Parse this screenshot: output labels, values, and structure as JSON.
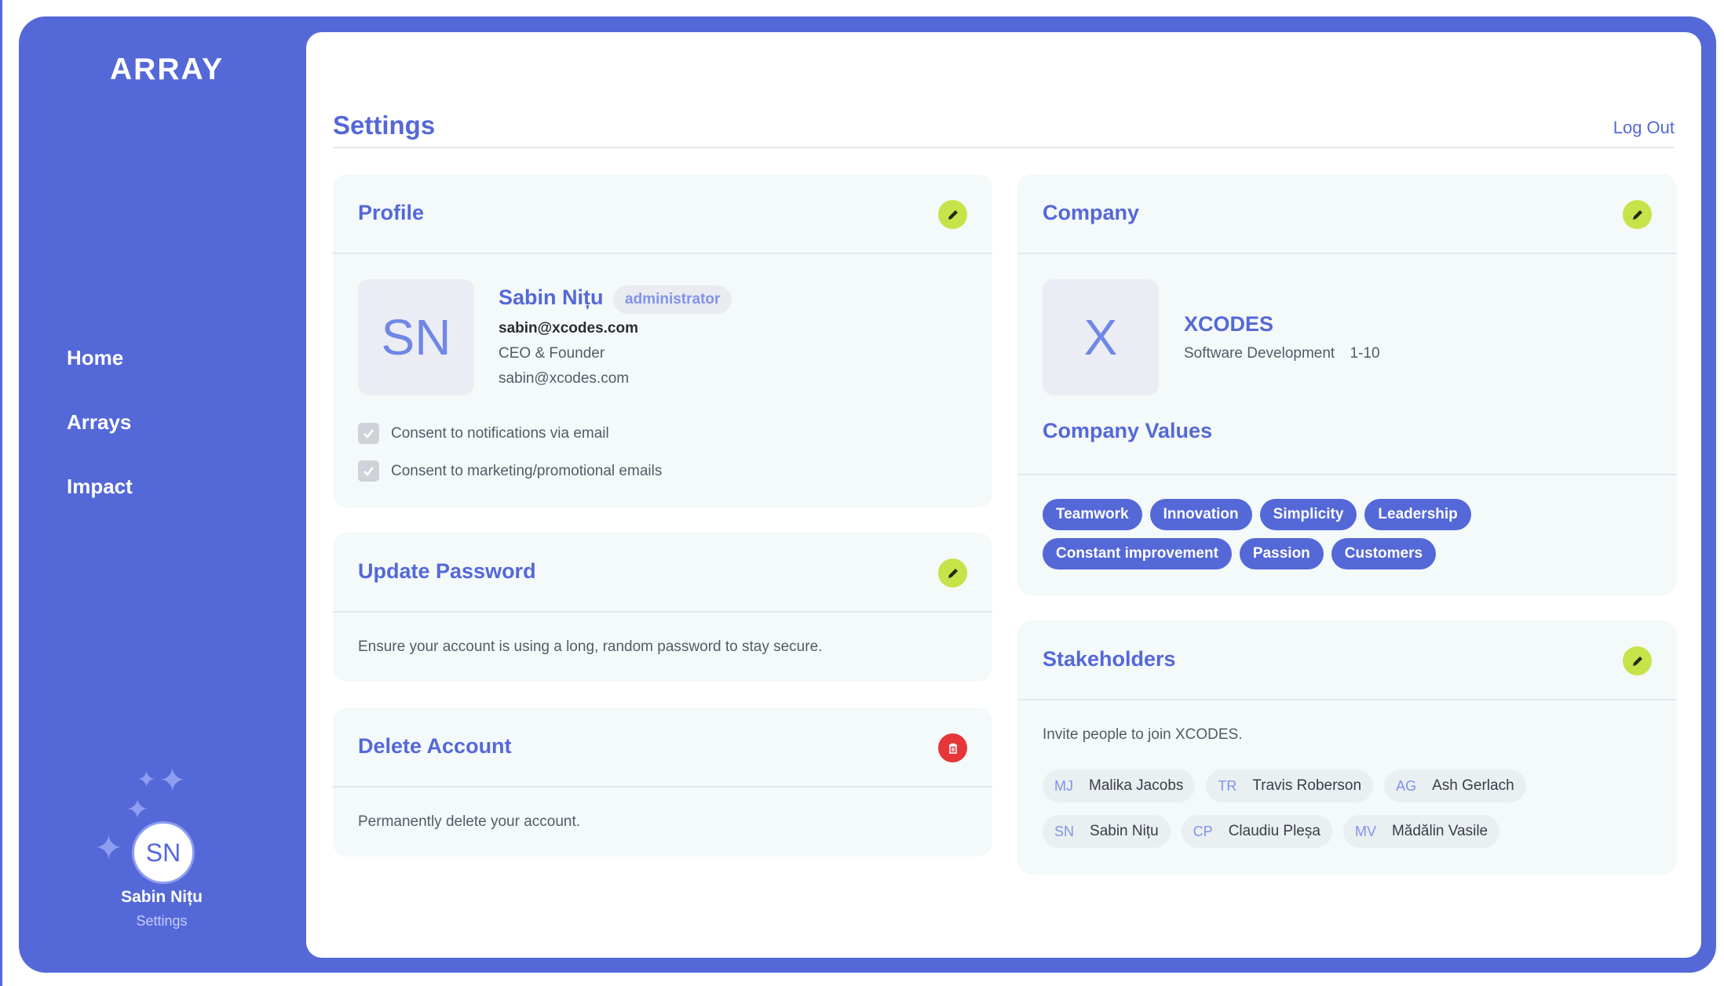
{
  "app": {
    "logo": "ARRAY"
  },
  "colors": {
    "brand": "#5468d8",
    "accent_edit": "#c7e34a",
    "danger": "#e5363a",
    "card_bg": "#f4f9fa"
  },
  "nav": {
    "items": [
      {
        "label": "Home"
      },
      {
        "label": "Arrays"
      },
      {
        "label": "Impact"
      }
    ]
  },
  "user": {
    "initials": "SN",
    "name": "Sabin Nițu",
    "subtitle": "Settings"
  },
  "header": {
    "title": "Settings",
    "logout_label": "Log Out"
  },
  "profile": {
    "title": "Profile",
    "initials": "SN",
    "name": "Sabin Nițu",
    "role": "administrator",
    "email_bold": "sabin@xcodes.com",
    "job_title": "CEO & Founder",
    "email": "sabin@xcodes.com",
    "consents": [
      {
        "label": "Consent to notifications via email",
        "checked": true
      },
      {
        "label": "Consent to marketing/promotional emails",
        "checked": true
      }
    ],
    "edit_icon": "pencil-icon"
  },
  "password": {
    "title": "Update Password",
    "description": "Ensure your account is using a long, random password to stay secure.",
    "edit_icon": "pencil-icon"
  },
  "delete_account": {
    "title": "Delete Account",
    "description": "Permanently delete your account.",
    "icon": "trash-icon"
  },
  "company": {
    "title": "Company",
    "logo_letter": "X",
    "name": "XCODES",
    "industry": "Software Development",
    "size": "1-10",
    "values_title": "Company Values",
    "values": [
      "Teamwork",
      "Innovation",
      "Simplicity",
      "Leadership",
      "Constant improvement",
      "Passion",
      "Customers"
    ],
    "edit_icon": "pencil-icon"
  },
  "stakeholders": {
    "title": "Stakeholders",
    "invite_text": "Invite people to join XCODES.",
    "people": [
      {
        "initials": "MJ",
        "name": "Malika Jacobs"
      },
      {
        "initials": "TR",
        "name": "Travis Roberson"
      },
      {
        "initials": "AG",
        "name": "Ash Gerlach"
      },
      {
        "initials": "SN",
        "name": "Sabin Nițu"
      },
      {
        "initials": "CP",
        "name": "Claudiu Pleșa"
      },
      {
        "initials": "MV",
        "name": "Mădălin Vasile"
      }
    ],
    "edit_icon": "pencil-icon"
  }
}
